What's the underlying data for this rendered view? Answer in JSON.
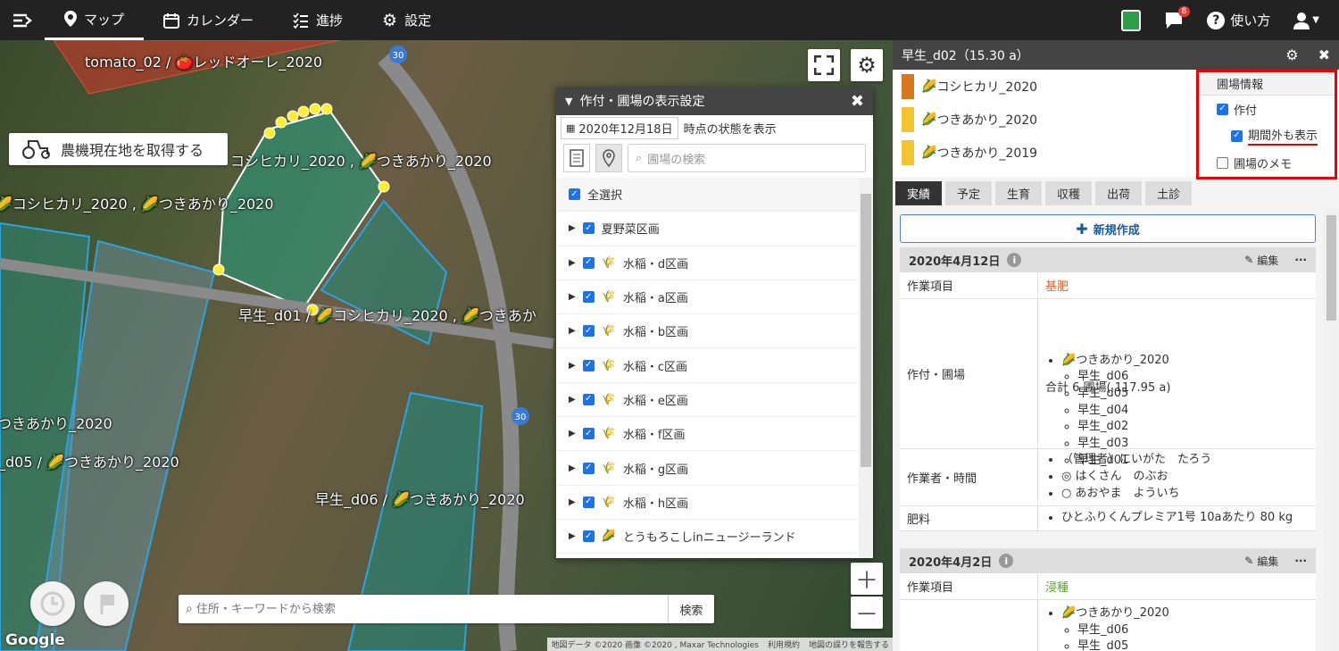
{
  "nav": {
    "items": [
      {
        "label": "マップ",
        "icon": "map-pin-icon"
      },
      {
        "label": "カレンダー",
        "icon": "calendar-icon"
      },
      {
        "label": "進捗",
        "icon": "checklist-icon"
      },
      {
        "label": "設定",
        "icon": "gear-icon"
      }
    ],
    "notification_count": "8",
    "help_label": "使い方"
  },
  "map": {
    "labels": [
      "tomato_02 / 🍅レッドオーレ_2020",
      "コシヒカリ_2020 , 🌽つきあかり_2020",
      "🌽コシヒカリ_2020 , 🌽つきあかり_2020",
      "早生_d01 / 🌽コシヒカリ_2020 , 🌽つきあか",
      "つきあかり_2020",
      "_d05 / 🌽つきあかり_2020",
      "早生_d06 / 🌽つきあかり_2020"
    ],
    "road_labels": [
      "30",
      "30"
    ],
    "machine_button": "農機現在地を取得する",
    "search_placeholder": "住所・キーワードから検索",
    "search_button": "検索",
    "google": "Google",
    "attribution": [
      "地図データ ©2020 画像 ©2020 , Maxar Technologies",
      "利用規約",
      "地図の誤りを報告する"
    ]
  },
  "dialog": {
    "title": "作付・圃場の表示設定",
    "date": "2020年12月18日",
    "date_suffix": "時点の状態を表示",
    "search_placeholder": "圃場の検索",
    "select_all": "全選択",
    "groups": [
      "夏野菜区画",
      "水稲・d区画",
      "水稲・a区画",
      "水稲・b区画",
      "水稲・c区画",
      "水稲・e区画",
      "水稲・f区画",
      "水稲・g区画",
      "水稲・h区画",
      "とうもろこしinニュージーランド"
    ]
  },
  "panel": {
    "title": "早生_d02（15.30 a）",
    "crops": [
      {
        "name": "コシヒカリ_2020",
        "color": "#d9771e"
      },
      {
        "name": "つきあかり_2020",
        "color": "#f4c430"
      },
      {
        "name": "つきあかり_2019",
        "color": "#f4c430"
      }
    ],
    "info_popup": {
      "title": "圃場情報",
      "sakutsuke": "作付",
      "out_of_period": "期間外も表示",
      "memo": "圃場のメモ"
    },
    "tabs": [
      "実績",
      "予定",
      "生育",
      "収穫",
      "出荷",
      "土診"
    ],
    "new_button": "新規作成",
    "records": [
      {
        "date": "2020年4月12日",
        "edit": "編集",
        "work_item_label": "作業項目",
        "work_item": "基肥",
        "work_item_color": "#e0662b",
        "field_label": "作付・圃場",
        "crop": "つきあかり_2020",
        "fields": [
          "早生_d06",
          "早生_d05",
          "早生_d04",
          "早生_d02",
          "早生_d03",
          "早生_d01"
        ],
        "total": "合計 6 圃場( 117.95 a)",
        "worker_label": "作業者・時間",
        "workers": [
          "（管理者）にいがた　たろう",
          "◎ はくさん　のぶお",
          "○ あおやま　よういち"
        ],
        "fertilizer_label": "肥料",
        "fertilizer": "ひとふりくんプレミア1号 10aあたり 80 kg"
      },
      {
        "date": "2020年4月2日",
        "edit": "編集",
        "work_item_label": "作業項目",
        "work_item": "浸種",
        "work_item_color": "#5aa02c",
        "crop": "つきあかり_2020",
        "fields": [
          "早生_d06",
          "早生_d05"
        ]
      }
    ]
  }
}
